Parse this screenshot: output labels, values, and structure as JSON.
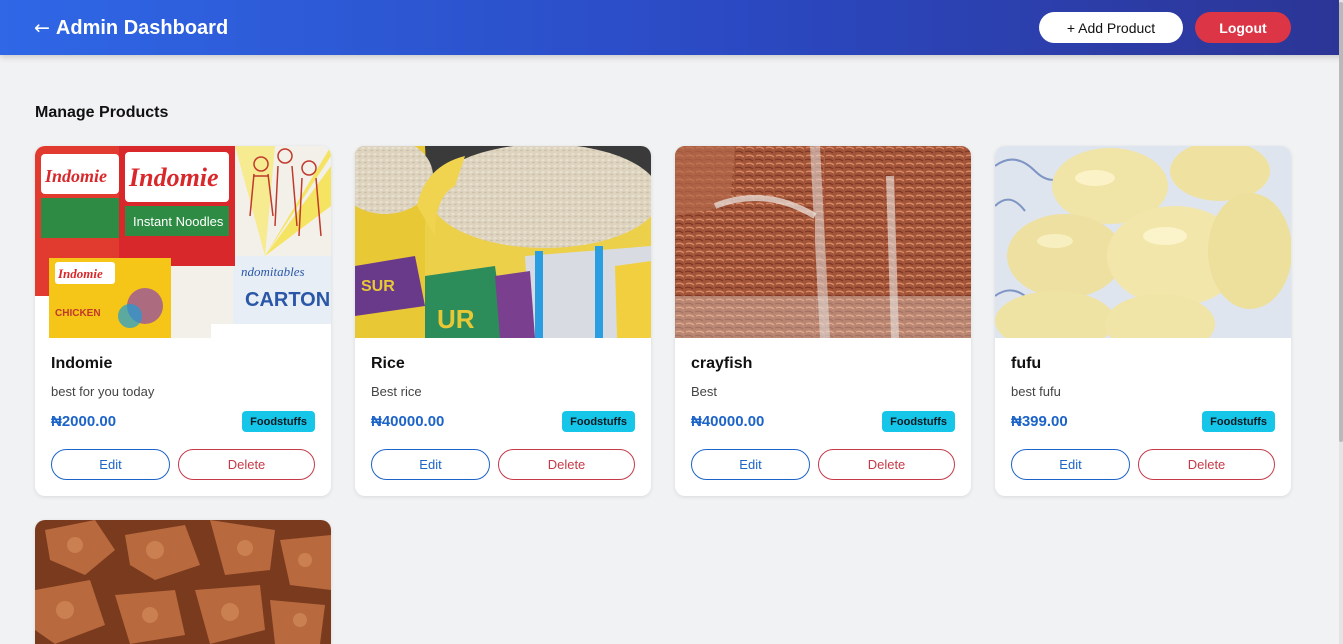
{
  "header": {
    "back_icon": "←",
    "title": "Admin Dashboard",
    "add_label": "+ Add Product",
    "logout_label": "Logout",
    "gradient": [
      "#2f67e6",
      "#2c3596"
    ]
  },
  "section_title": "Manage Products",
  "colors": {
    "price": "#1d64c8",
    "badge": "#16c6e8",
    "danger": "#dc3545"
  },
  "products": [
    {
      "name": "Indomie",
      "description": "best for you today",
      "price": "₦2000.00",
      "category": "Foodstuffs",
      "edit_label": "Edit",
      "delete_label": "Delete",
      "image": "indomie-carton-photo"
    },
    {
      "name": "Rice",
      "description": "Best rice",
      "price": "₦40000.00",
      "category": "Foodstuffs",
      "edit_label": "Edit",
      "delete_label": "Delete",
      "image": "rice-sack-photo"
    },
    {
      "name": "crayfish",
      "description": "Best",
      "price": "₦40000.00",
      "category": "Foodstuffs",
      "edit_label": "Edit",
      "delete_label": "Delete",
      "image": "crayfish-bags-photo"
    },
    {
      "name": "fufu",
      "description": "best fufu",
      "price": "₦399.00",
      "category": "Foodstuffs",
      "edit_label": "Edit",
      "delete_label": "Delete",
      "image": "fufu-balls-photo"
    },
    {
      "image": "fried-snack-photo"
    }
  ]
}
